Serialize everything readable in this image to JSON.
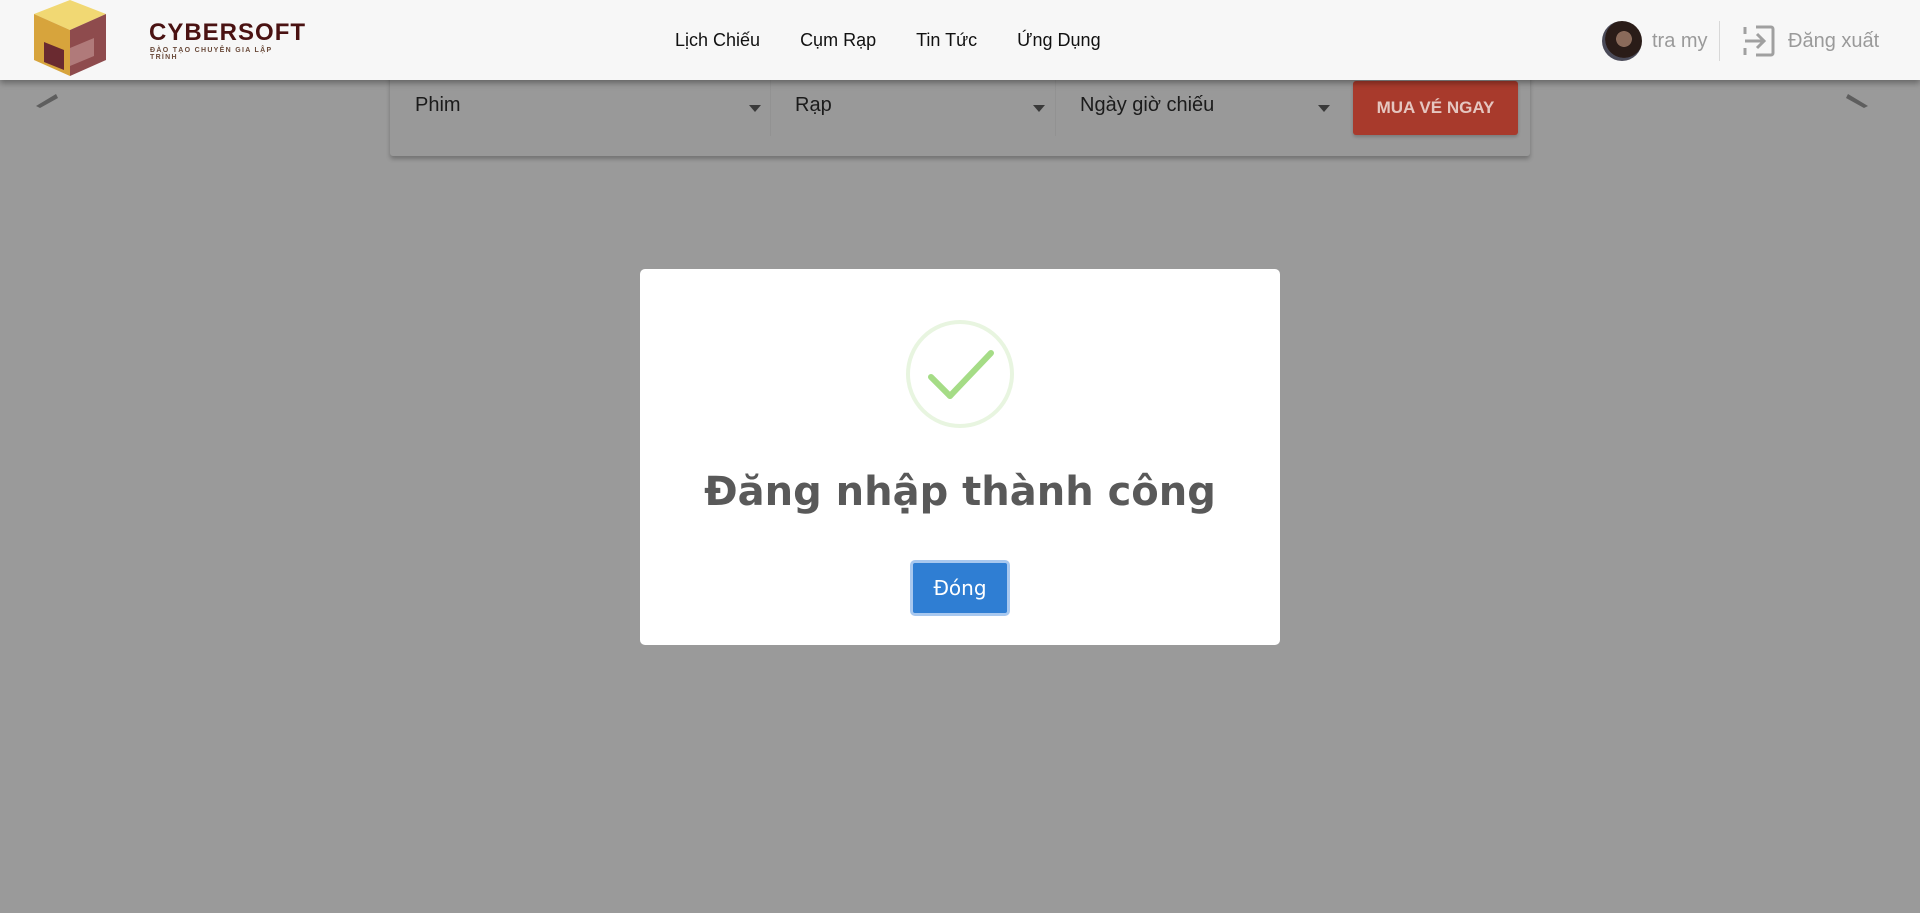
{
  "header": {
    "logo_text": "CYBERSOFT",
    "logo_subtitle": "ĐÀO TẠO CHUYÊN GIA LẬP TRÌNH",
    "nav": [
      {
        "label": "Lịch Chiếu"
      },
      {
        "label": "Cụm Rạp"
      },
      {
        "label": "Tin Tức"
      },
      {
        "label": "Ứng Dụng"
      }
    ],
    "user_name": "tra my",
    "logout_label": "Đăng xuất"
  },
  "search": {
    "movie_select": "Phim",
    "cinema_select": "Rạp",
    "showtime_select": "Ngày giờ chiếu",
    "buy_label": "MUA VÉ NGAY"
  },
  "modal": {
    "title": "Đăng nhập thành công",
    "close_label": "Đóng"
  },
  "colors": {
    "accent_red": "#a83a2c",
    "success_green": "#a5dc86",
    "button_blue": "#2f7ed3",
    "overlay": "#9a9a9a"
  }
}
